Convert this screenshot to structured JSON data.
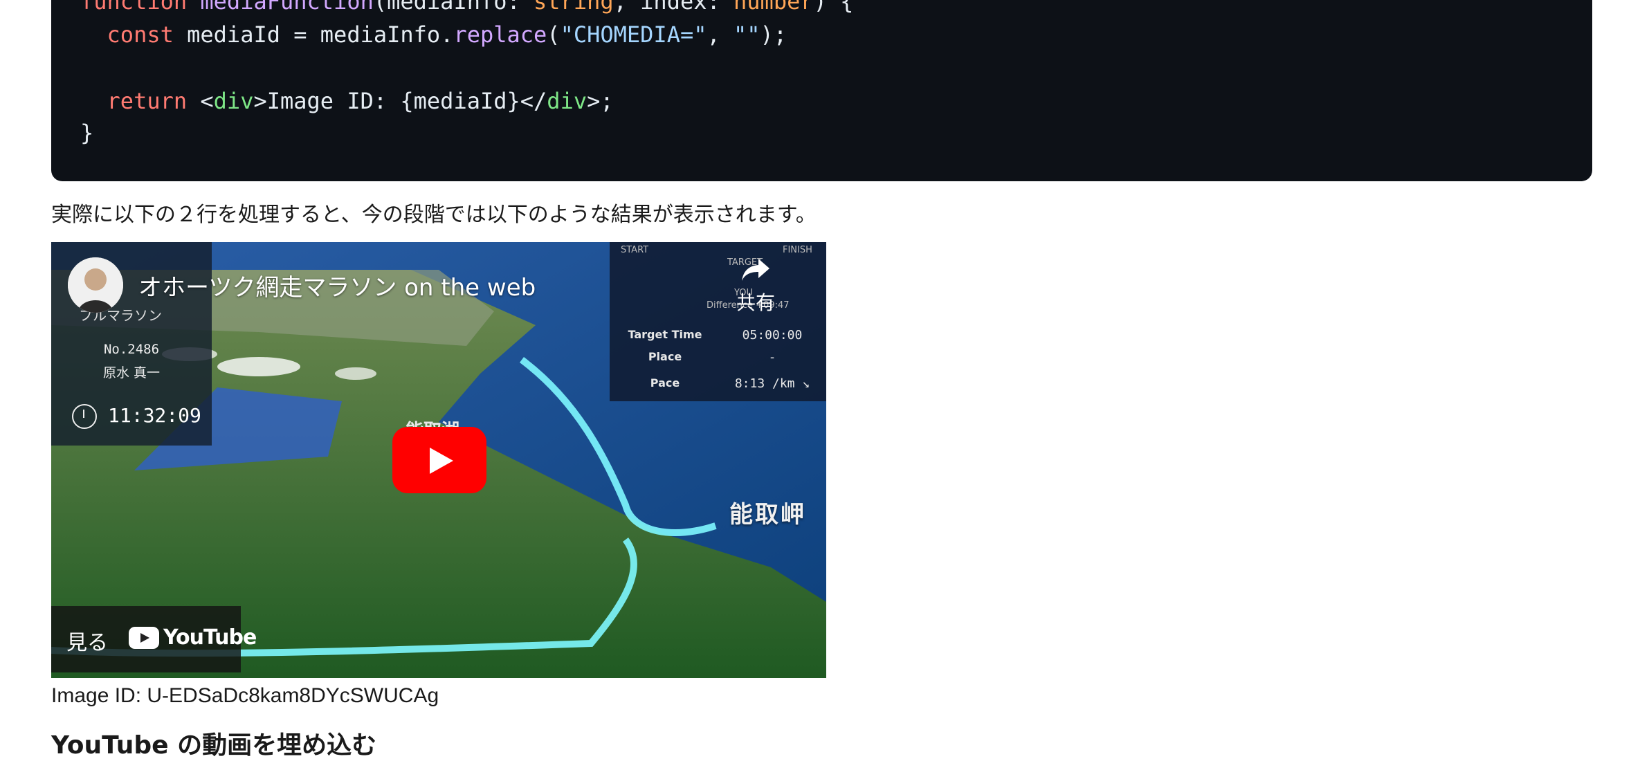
{
  "code": {
    "lines": [
      [
        {
          "t": "function ",
          "c": "kw"
        },
        {
          "t": "mediaFunction",
          "c": "fn"
        },
        {
          "t": "(mediaInfo: "
        },
        {
          "t": "string",
          "c": "ty"
        },
        {
          "t": ", index: "
        },
        {
          "t": "number",
          "c": "ty"
        },
        {
          "t": ") {"
        }
      ],
      [
        {
          "t": "  "
        },
        {
          "t": "const ",
          "c": "kw"
        },
        {
          "t": "mediaId = mediaInfo."
        },
        {
          "t": "replace",
          "c": "fn"
        },
        {
          "t": "("
        },
        {
          "t": "\"CHOMEDIA=\"",
          "c": "str"
        },
        {
          "t": ", "
        },
        {
          "t": "\"\"",
          "c": "str"
        },
        {
          "t": ");"
        }
      ],
      [
        {
          "t": ""
        }
      ],
      [
        {
          "t": "  "
        },
        {
          "t": "return ",
          "c": "kw"
        },
        {
          "t": "<"
        },
        {
          "t": "div",
          "c": "tag"
        },
        {
          "t": ">Image ID: {mediaId}</"
        },
        {
          "t": "div",
          "c": "tag"
        },
        {
          "t": ">;"
        }
      ],
      [
        {
          "t": "}"
        }
      ]
    ]
  },
  "prose": "実際に以下の２行を処理すると、今の段階では以下のような結果が表示されます。",
  "video": {
    "title": "オホーツク網走マラソン on the web",
    "share_label": "共有",
    "watch_label": "見る",
    "youtube_wordmark": "YouTube",
    "overlay_left": {
      "subtitle": "フルマラソン",
      "bib": "No.2486",
      "runner": "原水 真一",
      "elapsed": "11:32:09"
    },
    "overlay_right": {
      "start": "START",
      "target": "TARGET",
      "finish": "FINISH",
      "you": "YOU",
      "difference": "Difference +09:47",
      "rows": [
        {
          "key": "Target Time",
          "value": "05:00:00"
        },
        {
          "key": "Place",
          "value": "-"
        },
        {
          "key": "Pace",
          "value": "8:13 /km ↘"
        }
      ]
    },
    "map_labels": [
      "能取湖",
      "能取岬"
    ],
    "icons": [
      "channel-avatar",
      "share-arrow-icon",
      "play-icon",
      "youtube-logo-icon",
      "clock-icon"
    ]
  },
  "caption": "Image ID: U-EDSaDc8kam8DYcSWUCAg",
  "next_heading": "YouTube の動画を埋め込む",
  "colors": {
    "code_bg": "#0d1117",
    "keyword": "#ff7b72",
    "function": "#d2a8ff",
    "type": "#ffa657",
    "string": "#a5d6ff",
    "tag": "#7ee787",
    "play_button": "#ff0000"
  }
}
